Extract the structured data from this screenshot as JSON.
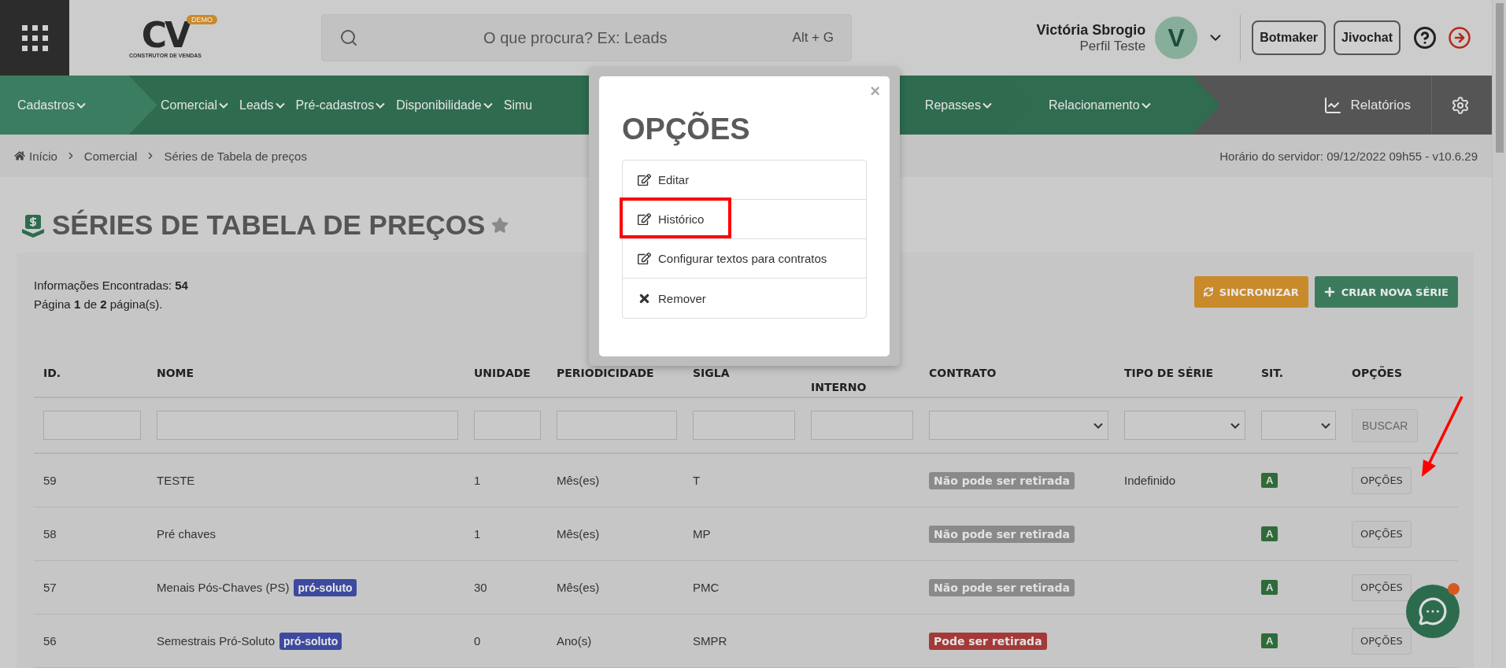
{
  "header": {
    "logo": {
      "mark": "CV",
      "badge": "DEMO",
      "tagline": "CONSTRUTOR DE VENDAS"
    },
    "search": {
      "placeholder": "O que procura? Ex: Leads",
      "shortcut": "Alt + G"
    },
    "user": {
      "name": "Victória Sbrogio",
      "profile": "Perfil Teste",
      "initial": "V"
    },
    "buttons": [
      "Botmaker",
      "Jivochat"
    ]
  },
  "nav": {
    "segments": [
      {
        "items": [
          {
            "label": "Cadastros",
            "caret": true
          }
        ]
      },
      {
        "items": [
          {
            "label": "Comercial",
            "caret": true
          },
          {
            "label": "Leads",
            "caret": true
          },
          {
            "label": "Pré-cadastros",
            "caret": true
          },
          {
            "label": "Disponibilidade",
            "caret": true
          },
          {
            "label": "Simu",
            "caret": false
          },
          {
            "label": "Repasses",
            "caret": true,
            "kind": "end"
          }
        ]
      },
      {
        "items": [
          {
            "label": "Relacionamento",
            "caret": true
          }
        ]
      }
    ],
    "reports": "Relatórios"
  },
  "breadcrumb": [
    "Início",
    "Comercial",
    "Séries de Tabela de preços"
  ],
  "server_time": "Horário do servidor: 09/12/2022 09h55 - v10.6.29",
  "page": {
    "title": "SÉRIES DE TABELA DE PREÇOS",
    "favorite": false
  },
  "info": [
    "Informações Encontradas: **54**",
    "Página **1** de **2** página(s)."
  ],
  "actions": [
    {
      "label": "SINCRONIZAR",
      "kind": "sync"
    },
    {
      "label": "CRIAR NOVA SÉRIE",
      "kind": "create"
    }
  ],
  "table": {
    "columns": [
      {
        "label": "ID.",
        "second_line": false
      },
      {
        "label": "NOME",
        "second_line": false
      },
      {
        "label": "UNIDADE",
        "second_line": false
      },
      {
        "label": "PERIODICIDADE",
        "second_line": false
      },
      {
        "label": "SIGLA",
        "second_line": false
      },
      {
        "label": "INTERNO",
        "second_line": true
      },
      {
        "label": "CONTRATO",
        "second_line": false
      },
      {
        "label": "TIPO DE SÉRIE",
        "second_line": false
      },
      {
        "label": "SIT.",
        "second_line": false
      },
      {
        "label": "OPÇÕES",
        "second_line": false
      }
    ],
    "filters": [
      {
        "kind": "text"
      },
      {
        "kind": "text"
      },
      {
        "kind": "text"
      },
      {
        "kind": "text"
      },
      {
        "kind": "text"
      },
      {
        "kind": "text"
      },
      {
        "kind": "select"
      },
      {
        "kind": "select"
      },
      {
        "kind": "select"
      },
      {
        "kind": "button",
        "label": "BUSCAR"
      }
    ],
    "rows": [
      {
        "id": "59",
        "name": "TESTE",
        "unit": "1",
        "period": "Mês(es)",
        "sigla": "T",
        "contract": {
          "label": "Não pode ser retirada",
          "color": "#8a8a8a"
        },
        "type": "Indefinido",
        "status": {
          "label": "A",
          "color": "#2f6b3a"
        },
        "button": "OPÇÕES"
      },
      {
        "id": "58",
        "name": "Pré chaves",
        "unit": "1",
        "period": "Mês(es)",
        "sigla": "MP",
        "contract": {
          "label": "Não pode ser retirada",
          "color": "#8a8a8a"
        },
        "status": {
          "label": "A",
          "color": "#2f6b3a"
        },
        "button": "OPÇÕES"
      },
      {
        "id": "57",
        "name": "Menais Pós-Chaves (PS)",
        "tag": "pró-soluto",
        "unit": "30",
        "period": "Mês(es)",
        "sigla": "PMC",
        "contract": {
          "label": "Não pode ser retirada",
          "color": "#8a8a8a"
        },
        "status": {
          "label": "A",
          "color": "#2f6b3a"
        },
        "button": "OPÇÕES"
      },
      {
        "id": "56",
        "name": "Semestrais Pró-Soluto",
        "tag": "pró-soluto",
        "unit": "0",
        "period": "Ano(s)",
        "sigla": "SMPR",
        "contract": {
          "label": "Pode ser retirada",
          "color": "#a33a38"
        },
        "status": {
          "label": "A",
          "color": "#2f6b3a"
        },
        "button": "OPÇÕES"
      }
    ]
  },
  "modal": {
    "title": "OPÇÕES",
    "close": "×",
    "items": [
      {
        "label": "Editar",
        "kind": "edit",
        "highlighted": false
      },
      {
        "label": "Histórico",
        "kind": "edit",
        "highlighted": true
      },
      {
        "label": "Configurar textos para contratos",
        "kind": "edit",
        "highlighted": false
      },
      {
        "label": "Remover",
        "kind": "remove",
        "highlighted": false
      }
    ]
  },
  "pointer_arrow": true,
  "chat": {
    "unread": true
  }
}
